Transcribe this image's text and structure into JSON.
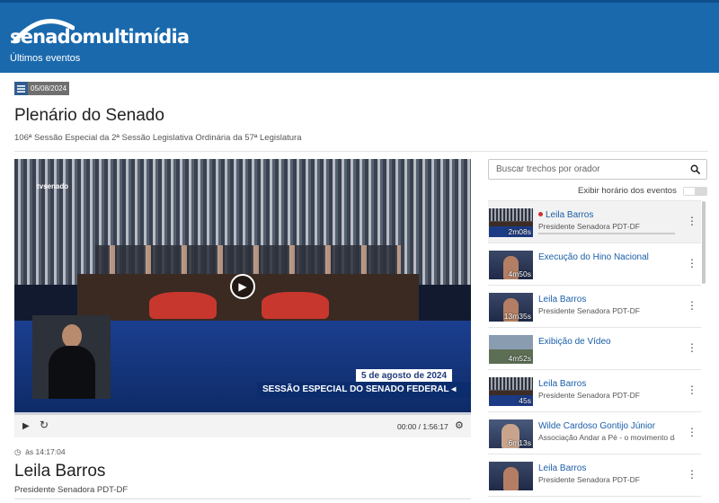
{
  "header": {
    "logo_bold": "senado",
    "logo_light": "multimídia",
    "nav_label": "Últimos eventos"
  },
  "event": {
    "date": "05/08/2024",
    "title": "Plenário do Senado",
    "subtitle": "106ª Sessão Especial da 2ª Sessão Legislativa Ordinária da 57ª Legislatura"
  },
  "video": {
    "channel_logo": "tvsenado",
    "overlay_date": "5 de agosto de 2024",
    "overlay_title": "SESSÃO ESPECIAL DO SENADO FEDERAL ◂",
    "time_display": "00:00 / 1:56:17",
    "play_icon": "play-icon",
    "reload_icon": "reload-icon",
    "settings_icon": "settings-icon"
  },
  "current_speaker": {
    "time": "às 14:17:04",
    "name": "Leila Barros",
    "role": "Presidente Senadora PDT-DF"
  },
  "sidebar": {
    "search_placeholder": "Buscar trechos por orador",
    "toggle_label": "Exibir horário dos eventos",
    "toggle_on": false,
    "items": [
      {
        "title": "Leila Barros",
        "subtitle": "Presidente Senadora PDT-DF",
        "duration": "2m08s",
        "active": true,
        "live": true,
        "thumb": "plenary"
      },
      {
        "title": "Execução do Hino Nacional",
        "subtitle": "",
        "duration": "4m50s",
        "active": false,
        "live": false,
        "thumb": "speaker"
      },
      {
        "title": "Leila Barros",
        "subtitle": "Presidente Senadora PDT-DF",
        "duration": "13m35s",
        "active": false,
        "live": false,
        "thumb": "speaker"
      },
      {
        "title": "Exibição de Vídeo",
        "subtitle": "",
        "duration": "4m52s",
        "active": false,
        "live": false,
        "thumb": "outdoor"
      },
      {
        "title": "Leila Barros",
        "subtitle": "Presidente Senadora PDT-DF",
        "duration": "45s",
        "active": false,
        "live": false,
        "thumb": "plenary"
      },
      {
        "title": "Wilde Cardoso Gontijo Júnior",
        "subtitle": "Associação Andar a Pé - o movimento da",
        "duration": "6m13s",
        "active": false,
        "live": false,
        "thumb": "man"
      },
      {
        "title": "Leila Barros",
        "subtitle": "Presidente Senadora PDT-DF",
        "duration": "",
        "active": false,
        "live": false,
        "thumb": "speaker"
      }
    ]
  }
}
